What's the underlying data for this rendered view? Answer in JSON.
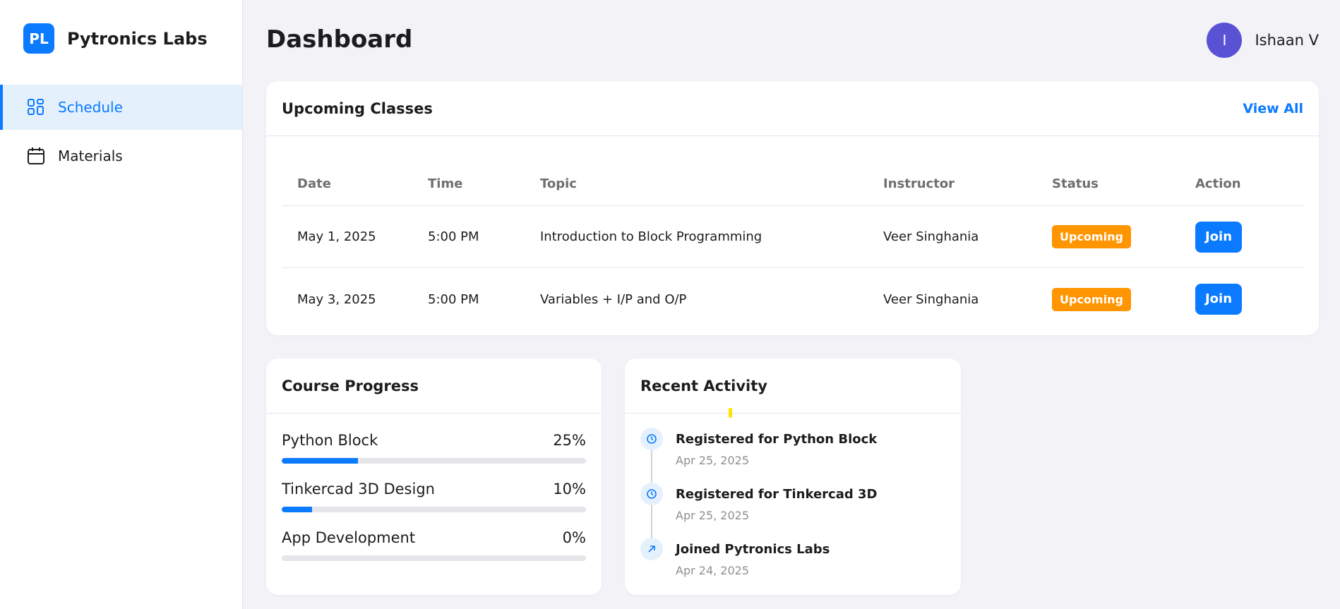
{
  "brand": {
    "logo_text": "PL",
    "name": "Pytronics Labs"
  },
  "nav": [
    {
      "label": "Schedule",
      "icon": "grid-icon",
      "active": true
    },
    {
      "label": "Materials",
      "icon": "calendar-icon",
      "active": false
    }
  ],
  "header": {
    "title": "Dashboard",
    "user": {
      "initial": "I",
      "name": "Ishaan V"
    }
  },
  "classes": {
    "title": "Upcoming Classes",
    "view_all": "View All",
    "columns": [
      "Date",
      "Time",
      "Topic",
      "Instructor",
      "Status",
      "Action"
    ],
    "rows": [
      {
        "date": "May 1, 2025",
        "time": "5:00 PM",
        "topic": "Introduction to Block Programming",
        "instructor": "Veer Singhania",
        "status": "Upcoming",
        "action": "Join"
      },
      {
        "date": "May 3, 2025",
        "time": "5:00 PM",
        "topic": "Variables + I/P and O/P",
        "instructor": "Veer Singhania",
        "status": "Upcoming",
        "action": "Join"
      }
    ]
  },
  "progress": {
    "title": "Course Progress",
    "items": [
      {
        "name": "Python Block",
        "percent_label": "25%",
        "fraction": 0.25
      },
      {
        "name": "Tinkercad 3D Design",
        "percent_label": "10%",
        "fraction": 0.1
      },
      {
        "name": "App Development",
        "percent_label": "0%",
        "fraction": 0.0
      }
    ]
  },
  "activity": {
    "title": "Recent Activity",
    "items": [
      {
        "title": "Registered for Python Block",
        "date": "Apr 25, 2025",
        "icon": "clock-icon"
      },
      {
        "title": "Registered for Tinkercad 3D",
        "date": "Apr 25, 2025",
        "icon": "clock-icon"
      },
      {
        "title": "Joined Pytronics Labs",
        "date": "Apr 24, 2025",
        "icon": "arrow-up-right-icon"
      }
    ]
  },
  "colors": {
    "accent": "#0a7aff",
    "status_upcoming": "#ff9500",
    "avatar": "#5a52d5",
    "background": "#f2f2f7"
  }
}
